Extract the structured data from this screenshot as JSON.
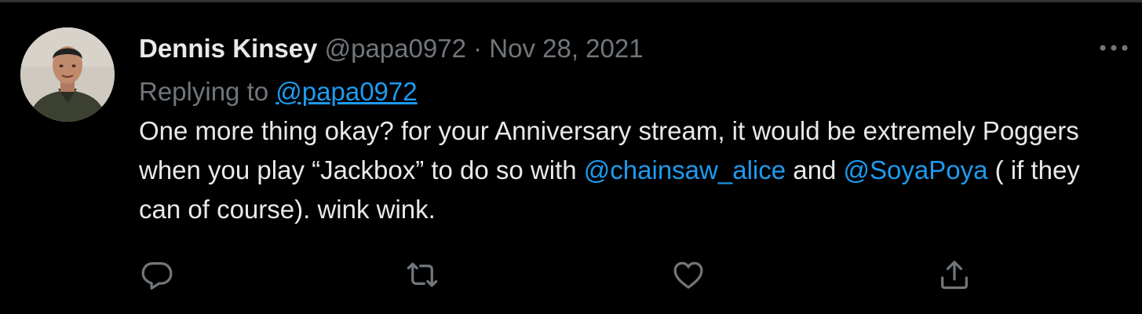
{
  "tweet": {
    "display_name": "Dennis Kinsey",
    "handle": "@papa0972",
    "separator": "·",
    "timestamp": "Nov 28, 2021",
    "replying_to_label": "Replying to",
    "replying_to_handle": "@papa0972",
    "text_part1": "One more thing okay? for your Anniversary stream, it would be extremely Poggers when you play “Jackbox” to do so with",
    "mention1": "@chainsaw_alice",
    "text_part2": "and",
    "mention2": "@SoyaPoya",
    "text_part3": "( if they can of course). wink wink."
  },
  "icons": {
    "more": "more-horizontal-icon",
    "reply": "reply-icon",
    "retweet": "retweet-icon",
    "like": "heart-icon",
    "share": "share-icon"
  },
  "colors": {
    "background": "#000000",
    "text": "#e7e9ea",
    "secondary": "#71767b",
    "link": "#1d9bf0",
    "divider": "#2f3336"
  }
}
